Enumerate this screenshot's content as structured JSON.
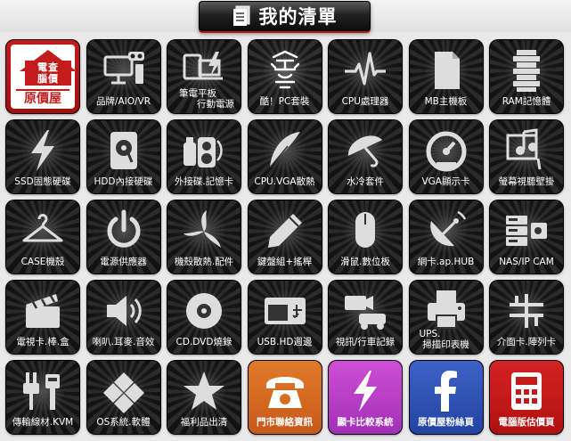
{
  "header": {
    "title": "我的清單",
    "icon": "list-document-icon"
  },
  "colors": {
    "brand_red": "#c21c1c",
    "stores_orange": "#d66d24",
    "compare_purple": "#b83dc6",
    "facebook_blue": "#3052b6",
    "quote_red": "#c41a1a"
  },
  "home_tile": {
    "brand_top": "電查",
    "brand_bottom": "腦價",
    "title": "原價屋"
  },
  "tiles": [
    {
      "name": "home-tile",
      "label": "",
      "icon": "home-logo"
    },
    {
      "name": "brand-aio-vr",
      "label": "品牌/AIO/VR",
      "icon": "desktop-vr-icon"
    },
    {
      "name": "notebook-tablet",
      "label_line1": "筆電平板",
      "label_line2": "行動電源",
      "icon": "laptop-tablet-icon"
    },
    {
      "name": "pro-pc-bundle",
      "label": "酷！PC套裝",
      "icon": "pro-pc-logo-icon"
    },
    {
      "name": "cpu",
      "label": "CPU處理器",
      "icon": "cpu-pulse-icon"
    },
    {
      "name": "motherboard",
      "label": "MB主機板",
      "icon": "board-document-icon"
    },
    {
      "name": "ram",
      "label": "RAM記憶體",
      "icon": "ram-stack-icon"
    },
    {
      "name": "ssd",
      "label": "SSD固態硬碟",
      "icon": "lightning-icon"
    },
    {
      "name": "hdd",
      "label": "HDD內接硬碟",
      "icon": "hard-disk-icon"
    },
    {
      "name": "external-storage",
      "label": "外接碟.記憶卡",
      "icon": "usb-speaker-icon"
    },
    {
      "name": "cpu-vga-cooling",
      "label": "CPU.VGA散熱",
      "icon": "feather-icon"
    },
    {
      "name": "water-cooling",
      "label": "水冷套件",
      "icon": "umbrella-icon"
    },
    {
      "name": "vga",
      "label": "VGA顯示卡",
      "icon": "gauge-icon"
    },
    {
      "name": "monitor",
      "label": "螢幕視聽壁掛",
      "icon": "music-note-icon"
    },
    {
      "name": "case",
      "label": "CASE機殼",
      "icon": "hanger-icon"
    },
    {
      "name": "power-supply",
      "label": "電源供應器",
      "icon": "power-icon"
    },
    {
      "name": "case-fan",
      "label": "機殼散熱.配件",
      "icon": "fan-blade-icon"
    },
    {
      "name": "keyboard",
      "label": "鍵盤組+搖桿",
      "icon": "pencil-icon"
    },
    {
      "name": "mouse",
      "label": "滑鼠.數位板",
      "icon": "mouse-icon"
    },
    {
      "name": "network",
      "label": "網卡.ap.HUB",
      "icon": "satellite-dish-icon"
    },
    {
      "name": "nas-ip-cam",
      "label": "NAS/IP CAM",
      "icon": "nas-camera-icon"
    },
    {
      "name": "tv-card",
      "label": "電視卡.棒.盒",
      "icon": "clapperboard-icon"
    },
    {
      "name": "speaker",
      "label": "喇叭.耳麥.音效",
      "icon": "speaker-icon"
    },
    {
      "name": "cd-dvd",
      "label": "CD.DVD燒錄",
      "icon": "disc-icon"
    },
    {
      "name": "usb-hd-box",
      "label": "USB.HD週邊",
      "icon": "usb-window-icon"
    },
    {
      "name": "dashcam",
      "label": "視訊/行車記錄",
      "icon": "camera-car-icon"
    },
    {
      "name": "ups-scanner",
      "label_line1": "UPS.",
      "label_line2": "掃描印表機",
      "icon": "printer-icon"
    },
    {
      "name": "interface-card",
      "label": "介面卡.陣列卡",
      "icon": "interface-icon"
    },
    {
      "name": "cable-kvm",
      "label": "傳輸線材.KVM",
      "icon": "plug-icon"
    },
    {
      "name": "os-software",
      "label": "OS系統.軟體",
      "icon": "windows-icon"
    },
    {
      "name": "clearance",
      "label": "福利品出清",
      "icon": "star-icon"
    },
    {
      "name": "stores-contact",
      "label": "門市聯絡資訊",
      "icon": "telephone-icon"
    },
    {
      "name": "graphics-compare",
      "label": "顯卡比較系統",
      "icon": "lightning-icon"
    },
    {
      "name": "facebook-fans",
      "label": "原價屋粉絲頁",
      "icon": "facebook-icon"
    },
    {
      "name": "pc-quote",
      "label": "電腦版估價頁",
      "icon": "calculator-icon"
    }
  ]
}
